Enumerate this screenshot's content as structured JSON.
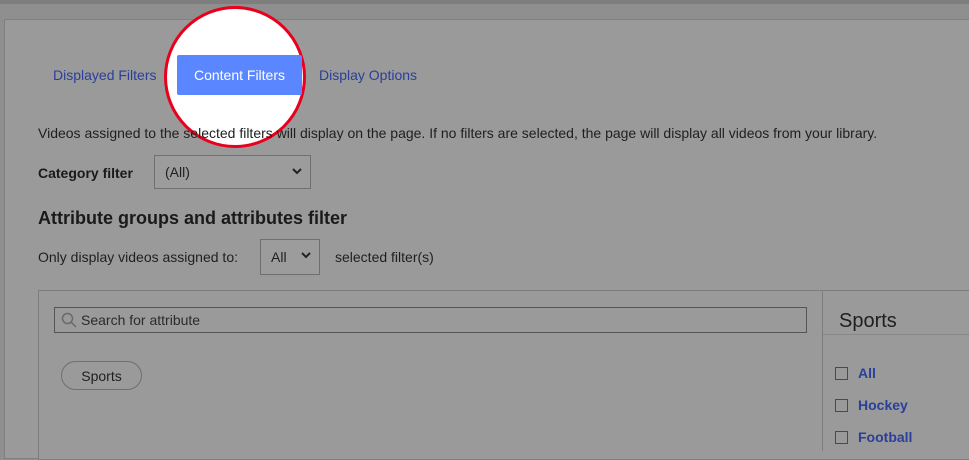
{
  "tabs": {
    "displayed_filters": "Displayed Filters",
    "content_filters": "Content Filters",
    "display_options": "Display Options"
  },
  "description": "Videos assigned to the selected filters will display on the page. If no filters are selected, the page will display all videos from your library.",
  "category_filter": {
    "label": "Category filter",
    "selected": "(All)"
  },
  "attributes": {
    "heading": "Attribute groups and attributes filter",
    "only_label": "Only display videos assigned to:",
    "match_selected": "All",
    "selected_label": "selected filter(s)",
    "search_placeholder": "Search for attribute",
    "groups": [
      "Sports"
    ]
  },
  "sports_panel": {
    "title": "Sports",
    "options": [
      "All",
      "Hockey",
      "Football"
    ]
  },
  "colors": {
    "active_tab": "#5a86ff",
    "link": "#2a3f99",
    "callout_ring": "#e8001c"
  },
  "icons": {
    "search": "search-icon",
    "chevron": "chevron-down-icon"
  }
}
